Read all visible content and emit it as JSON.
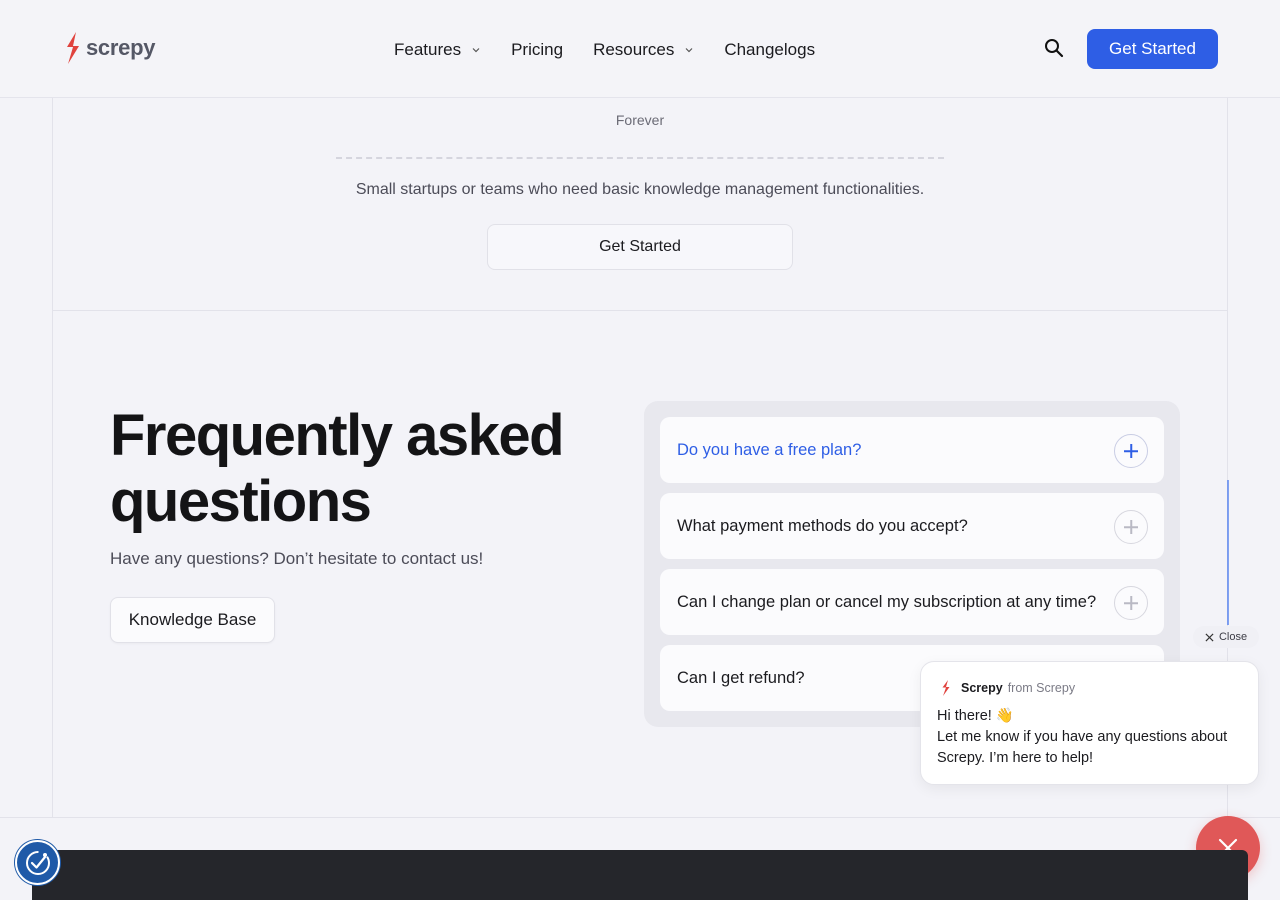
{
  "header": {
    "logo_text": "screpy",
    "nav": [
      {
        "label": "Features",
        "has_dropdown": true
      },
      {
        "label": "Pricing",
        "has_dropdown": false
      },
      {
        "label": "Resources",
        "has_dropdown": true
      },
      {
        "label": "Changelogs",
        "has_dropdown": false
      }
    ],
    "cta_label": "Get Started",
    "search_icon": "search-icon"
  },
  "pricing": {
    "period": "Forever",
    "description": "Small startups or teams who need basic knowledge management functionalities.",
    "cta_label": "Get Started"
  },
  "faq": {
    "title": "Frequently asked questions",
    "subtitle": "Have any questions? Don’t hesitate to contact us!",
    "kb_button": "Knowledge Base",
    "items": [
      {
        "question": "Do you have a free plan?",
        "active": true
      },
      {
        "question": "What payment methods do you accept?",
        "active": false
      },
      {
        "question": "Can I change plan or cancel my subscription at any time?",
        "active": false
      },
      {
        "question": "Can I get refund?",
        "active": false
      }
    ]
  },
  "chat": {
    "close_label": "Close",
    "sender": "Screpy",
    "from": "from Screpy",
    "greeting": "Hi there! 👋",
    "message": "Let me know if you have any questions about Screpy. I’m here to help!"
  },
  "colors": {
    "accent": "#2e5ee5",
    "chat_fab": "#e05858",
    "brand_red": "#e0433e",
    "a11y": "#1f5aa8",
    "background": "#f3f3f8"
  }
}
